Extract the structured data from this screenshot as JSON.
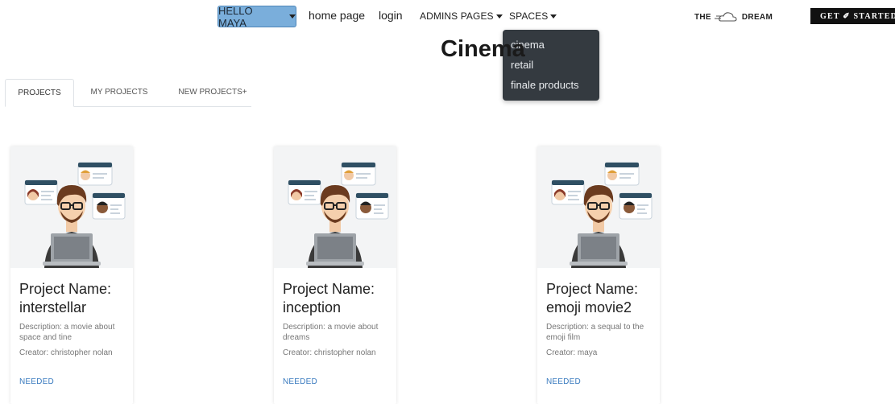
{
  "nav": {
    "hello_label": "HELLO MAYA",
    "home": "home page",
    "login": "login",
    "admins": "ADMINS PAGES",
    "spaces": "SPACES",
    "brand_left": "THE",
    "brand_right": "DREAM",
    "cta": "GET ✐ STARTED"
  },
  "dropdown": {
    "items": [
      "cinema",
      "retail",
      "finale products"
    ]
  },
  "page": {
    "title": "Cinema"
  },
  "tabs": [
    "PROJECTS",
    "MY PROJECTS",
    "NEW PROJECTS+"
  ],
  "cards": [
    {
      "title": "Project Name: interstellar",
      "description": "Description: a movie about space and tine",
      "creator": "Creator: christopher nolan",
      "link": "NEEDED"
    },
    {
      "title": "Project Name: inception",
      "description": "Description: a movie about dreams",
      "creator": "Creator: christopher nolan",
      "link": "NEEDED"
    },
    {
      "title": "Project Name: emoji movie2",
      "description": "Description: a sequal to the emoji film",
      "creator": "Creator: maya",
      "link": "NEEDED"
    }
  ],
  "icons": {
    "user_button_caret": "caret-down-icon",
    "brand": "cloud-icon",
    "card_image": "person-laptop-illustration"
  },
  "colors": {
    "primary_button": "#7aaedb",
    "dropdown_bg": "#343a40",
    "link": "#3a7bbf"
  }
}
